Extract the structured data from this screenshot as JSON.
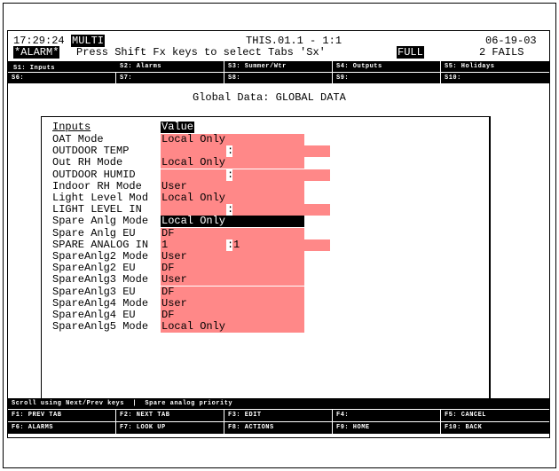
{
  "header": {
    "time": "17:29:24",
    "mode": "MULTI",
    "location": "THIS.01.1 - 1:1",
    "date": "06-19-03",
    "alarm_badge": "*ALARM*",
    "instruction": "Press Shift Fx keys to select Tabs 'Sx'",
    "view_badge": "FULL",
    "fails": "2 FAILS"
  },
  "tabs_row1": [
    {
      "label": "S1: Inputs",
      "selected": true
    },
    {
      "label": "S2: Alarms"
    },
    {
      "label": "S3: Summer/Wtr"
    },
    {
      "label": "S4: Outputs"
    },
    {
      "label": "S5: Holidays"
    }
  ],
  "tabs_row2": [
    {
      "label": "S6:"
    },
    {
      "label": "S7:"
    },
    {
      "label": "S8:"
    },
    {
      "label": "S9:"
    },
    {
      "label": "S10:"
    }
  ],
  "page_title": "Global Data: GLOBAL DATA",
  "table": {
    "col_inputs": "Inputs",
    "col_value": "Value",
    "rows": [
      {
        "label": "OAT Mode",
        "value": "Local Only",
        "type": "single"
      },
      {
        "label": "OUTDOOR TEMP",
        "value": "",
        "value2": "",
        "type": "double"
      },
      {
        "label": "Out RH Mode",
        "value": "Local Only",
        "type": "single"
      },
      {
        "label": "OUTDOOR HUMID",
        "value": "",
        "value2": "",
        "type": "double"
      },
      {
        "label": "Indoor RH Mode",
        "value": "User",
        "type": "single"
      },
      {
        "label": "Light Level Mod",
        "value": "Local Only",
        "type": "single"
      },
      {
        "label": "LIGHT LEVEL IN",
        "value": "",
        "value2": "",
        "type": "double"
      },
      {
        "label": "Spare Anlg Mode",
        "value": "Local Only",
        "type": "single",
        "selected": true
      },
      {
        "label": "Spare Anlg EU",
        "value": "DF",
        "type": "single"
      },
      {
        "label": "SPARE ANALOG IN",
        "value": "1",
        "value2": "1",
        "type": "double"
      },
      {
        "label": "SpareAnlg2 Mode",
        "value": "User",
        "type": "single"
      },
      {
        "label": "SpareAnlg2 EU",
        "value": "DF",
        "type": "single"
      },
      {
        "label": "SpareAnlg3 Mode",
        "value": "User",
        "type": "single"
      },
      {
        "label": "SpareAnlg3 EU",
        "value": "DF",
        "type": "single"
      },
      {
        "label": "SpareAnlg4 Mode",
        "value": "User",
        "type": "single"
      },
      {
        "label": "SpareAnlg4 EU",
        "value": "DF",
        "type": "single"
      },
      {
        "label": "SpareAnlg5 Mode",
        "value": "Local Only",
        "type": "single"
      }
    ]
  },
  "status_line": "Scroll using Next/Prev keys  |  Spare analog priority",
  "fkeys_row1": [
    "F1: PREV TAB",
    "F2: NEXT TAB",
    "F3: EDIT",
    "F4:",
    "F5: CANCEL"
  ],
  "fkeys_row2": [
    "F6: ALARMS",
    "F7: LOOK UP",
    "F8: ACTIONS",
    "F9: HOME",
    "F10: BACK"
  ],
  "colors": {
    "field": "#ff8888",
    "selected_field": "#000000"
  }
}
